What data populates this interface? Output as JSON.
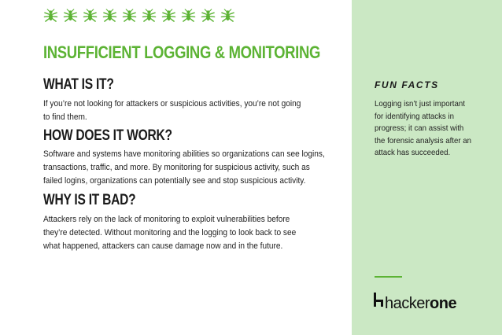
{
  "title": "INSUFFICIENT LOGGING & MONITORING",
  "bug_icon_count": 10,
  "colors": {
    "accent": "#5cb334",
    "sidebar": "#cbe8c4",
    "text": "#1a1a1a"
  },
  "sections": [
    {
      "heading": "WHAT IS IT?",
      "lines": [
        "If you’re not looking for attackers or suspicious activities, you’re not going",
        "to find them."
      ]
    },
    {
      "heading": "HOW DOES IT WORK?",
      "lines": [
        "Software and systems have monitoring abilities so organizations can see logins,",
        "transactions, traffic, and more. By monitoring for suspicious activity, such as",
        "failed logins, organizations can potentially see and stop suspicious activity."
      ]
    },
    {
      "heading": "WHY IS IT BAD?",
      "lines": [
        "Attackers rely on the lack of monitoring to exploit vulnerabilities before",
        "they’re detected. Without monitoring and the logging to look back to see",
        "what happened, attackers can cause damage now and in the future."
      ]
    }
  ],
  "fun_facts": {
    "heading": "FUN FACTS",
    "lines": [
      "Logging isn’t just important",
      "for identifying attacks in",
      "progress; it can assist with",
      "the forensic analysis after an",
      "attack has succeeded."
    ]
  },
  "logo": {
    "light": "hacker",
    "bold": "one"
  }
}
